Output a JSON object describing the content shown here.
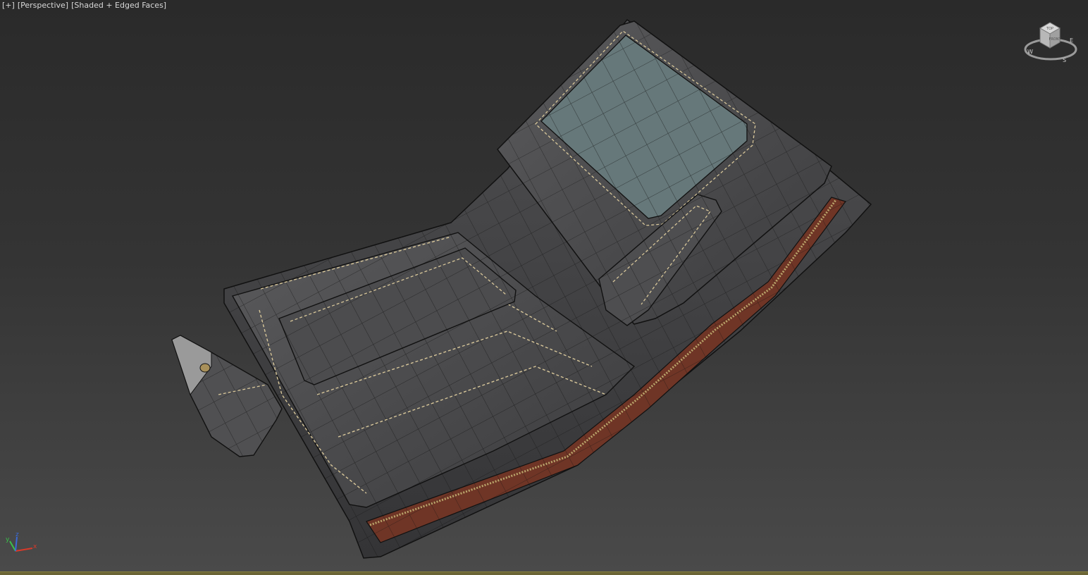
{
  "viewport": {
    "menu_plus": "[+]",
    "view_label": "[Perspective]",
    "shading_label": "[Shaded + Edged Faces]"
  },
  "viewcube": {
    "top_label": "TOP",
    "front_label": "FRONT",
    "compass_w": "W",
    "compass_s": "S",
    "compass_e": "E"
  },
  "axis": {
    "x_label": "x",
    "y_label": "y",
    "z_label": "z",
    "x_color": "#d83a2a",
    "y_color": "#3ac24a",
    "z_color": "#3a6ad8"
  },
  "scene": {
    "object": "wallet-model",
    "leather_color": "#4a4a4c",
    "stitch_color": "#d8c79a",
    "zipper_lining_color": "#7a3a2a",
    "window_color": "#66787a"
  }
}
